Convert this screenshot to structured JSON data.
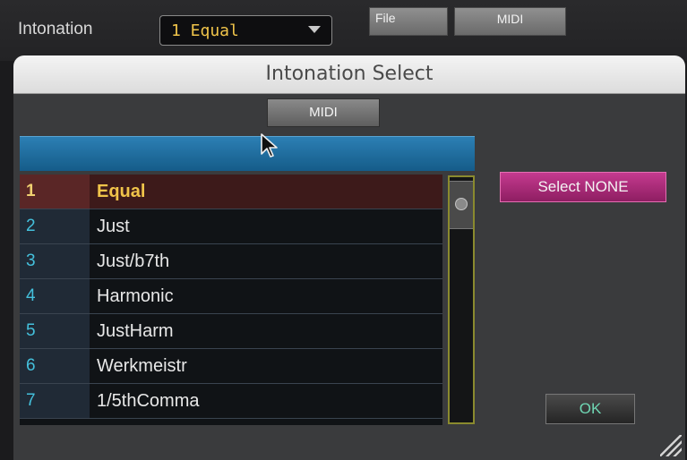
{
  "topbar": {
    "label": "Intonation",
    "select_value": "1  Equal",
    "file_button": "File",
    "midi_button": "MIDI"
  },
  "dialog": {
    "title": "Intonation Select",
    "midi_button": "MIDI",
    "select_none_button": "Select NONE",
    "ok_button": "OK",
    "rows": [
      {
        "num": "1",
        "name": "Equal",
        "selected": true
      },
      {
        "num": "2",
        "name": "Just"
      },
      {
        "num": "3",
        "name": "Just/b7th"
      },
      {
        "num": "4",
        "name": "Harmonic"
      },
      {
        "num": "5",
        "name": "JustHarm"
      },
      {
        "num": "6",
        "name": "Werkmeistr"
      },
      {
        "num": "7",
        "name": "1/5thComma"
      }
    ]
  },
  "icons": {
    "dropdown": "chevron-down-icon",
    "scroll": "scroll-thumb-icon",
    "resize": "resize-grip-icon",
    "cursor": "mouse-cursor-icon"
  },
  "colors": {
    "accent_yellow": "#f0c44a",
    "number_cyan": "#44c0dc",
    "select_none_magenta": "#b52e80",
    "ok_green": "#6fd6b3",
    "header_blue": "#1f6fa3"
  }
}
